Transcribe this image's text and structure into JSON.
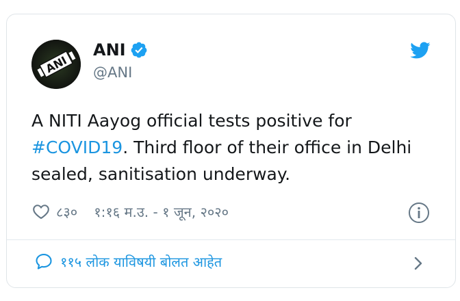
{
  "author": {
    "name": "ANI",
    "handle": "@ANI",
    "avatar_text": "ANI",
    "verified_icon": "verified-badge-icon"
  },
  "tweet": {
    "text_before": "A NITI Aayog official tests positive for ",
    "hashtag": "#COVID19",
    "text_after": ". Third floor of their office in Delhi sealed, sanitisation underway."
  },
  "meta": {
    "like_count": "८३०",
    "timestamp": "१:१६ म.उ. - १ जून, २०२०"
  },
  "footer": {
    "replies_label": "११५ लोक याविषयी बोलत आहेत"
  },
  "colors": {
    "accent": "#1b95e0",
    "verified": "#1da1f2",
    "muted": "#657786",
    "text": "#14171a",
    "border": "#dfe4e8"
  },
  "icons": [
    "verified-badge-icon",
    "twitter-bird-icon",
    "heart-icon",
    "info-icon",
    "reply-bubble-icon",
    "chevron-right-icon"
  ]
}
